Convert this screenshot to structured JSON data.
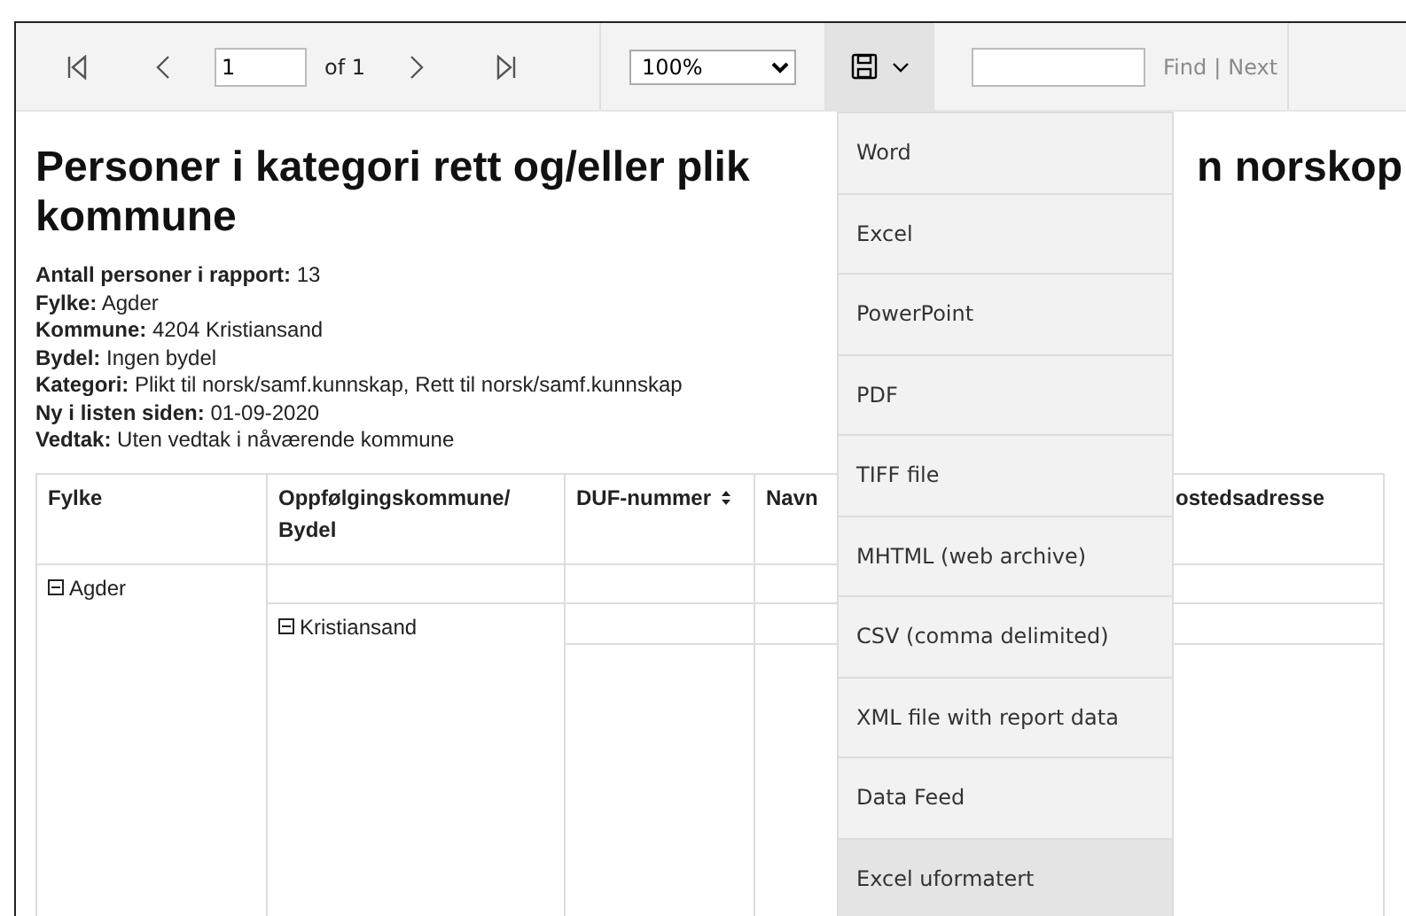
{
  "toolbar": {
    "page_value": "1",
    "page_of": "of 1",
    "zoom": "100%",
    "export_expanded": true,
    "find_label": "Find",
    "find_separator": "|",
    "next_label": "Next",
    "find_disabled": true
  },
  "export_menu": [
    {
      "label": "Word",
      "highlighted": false
    },
    {
      "label": "Excel",
      "highlighted": false
    },
    {
      "label": "PowerPoint",
      "highlighted": false
    },
    {
      "label": "PDF",
      "highlighted": false
    },
    {
      "label": "TIFF file",
      "highlighted": false
    },
    {
      "label": "MHTML (web archive)",
      "highlighted": false
    },
    {
      "label": "CSV (comma delimited)",
      "highlighted": false
    },
    {
      "label": "XML file with report data",
      "highlighted": false
    },
    {
      "label": "Data Feed",
      "highlighted": false
    },
    {
      "label": "Excel uformatert",
      "highlighted": true
    }
  ],
  "report": {
    "title_left": "Personer i kategori rett og/eller plik",
    "title_right": "n norskop",
    "title_line2": "kommune",
    "info": [
      "**Antall personer i rapport:** 13",
      "**Fylke:** Agder",
      "**Kommune:** 4204 Kristiansand",
      "**Bydel:** Ingen bydel",
      "**Kategori:** Plikt til norsk/samf.kunnskap, Rett til norsk/samf.kunnskap",
      "**Ny i listen siden:** 01-09-2020",
      "**Vedtak:** Uten vedtak i nåværende kommune"
    ],
    "table": {
      "columns": [
        {
          "label": "Fylke",
          "sortable": false
        },
        {
          "label": "Oppfølgingskommune/ Bydel",
          "sortable": false
        },
        {
          "label": "DUF-nummer",
          "sortable": true
        },
        {
          "label": "Navn",
          "sortable": false
        },
        {
          "label": "ostedsadresse",
          "sortable": false
        }
      ],
      "groups": [
        {
          "label": "Agder",
          "expanded": true,
          "children": [
            {
              "label": "Kristiansand",
              "expanded": true
            }
          ]
        }
      ]
    }
  }
}
